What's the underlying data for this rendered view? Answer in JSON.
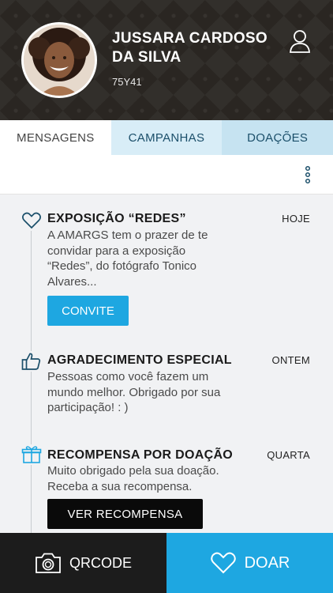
{
  "profile": {
    "name": "JUSSARA CARDOSO DA SILVA",
    "code": "75Y41"
  },
  "tabs": [
    {
      "label": "MENSAGENS",
      "active": true
    },
    {
      "label": "CAMPANHAS",
      "active": false
    },
    {
      "label": "DOAÇÕES",
      "active": false
    }
  ],
  "icons": {
    "profile": "user-icon",
    "more": "more-vertical-icon",
    "message1": "heart-icon",
    "message2": "thumbs-up-icon",
    "message3": "gift-icon",
    "qrcode": "camera-icon",
    "donate": "heart-icon"
  },
  "messages": [
    {
      "title": "EXPOSIÇÃO “REDES”",
      "date": "HOJE",
      "body": "A AMARGS tem o prazer de te convidar para a exposição “Redes”, do fotógrafo Tonico Alvares...",
      "action": "CONVITE"
    },
    {
      "title": "AGRADECIMENTO ESPECIAL",
      "date": "ONTEM",
      "body": "Pessoas como você fazem um mundo melhor. Obrigado por sua participação! : )"
    },
    {
      "title": "RECOMPENSA POR DOAÇÃO",
      "date": "QUARTA",
      "body": "Muito obrigado pela sua doação. Receba a sua recompensa.",
      "action": "VER RECOMPENSA"
    }
  ],
  "bottom_bar": {
    "qrcode_label": "QRCODE",
    "donate_label": "DOAR"
  },
  "colors": {
    "accent": "#1ea7e1",
    "dark": "#1c1c1c",
    "tab_light": "#d8edf7"
  }
}
